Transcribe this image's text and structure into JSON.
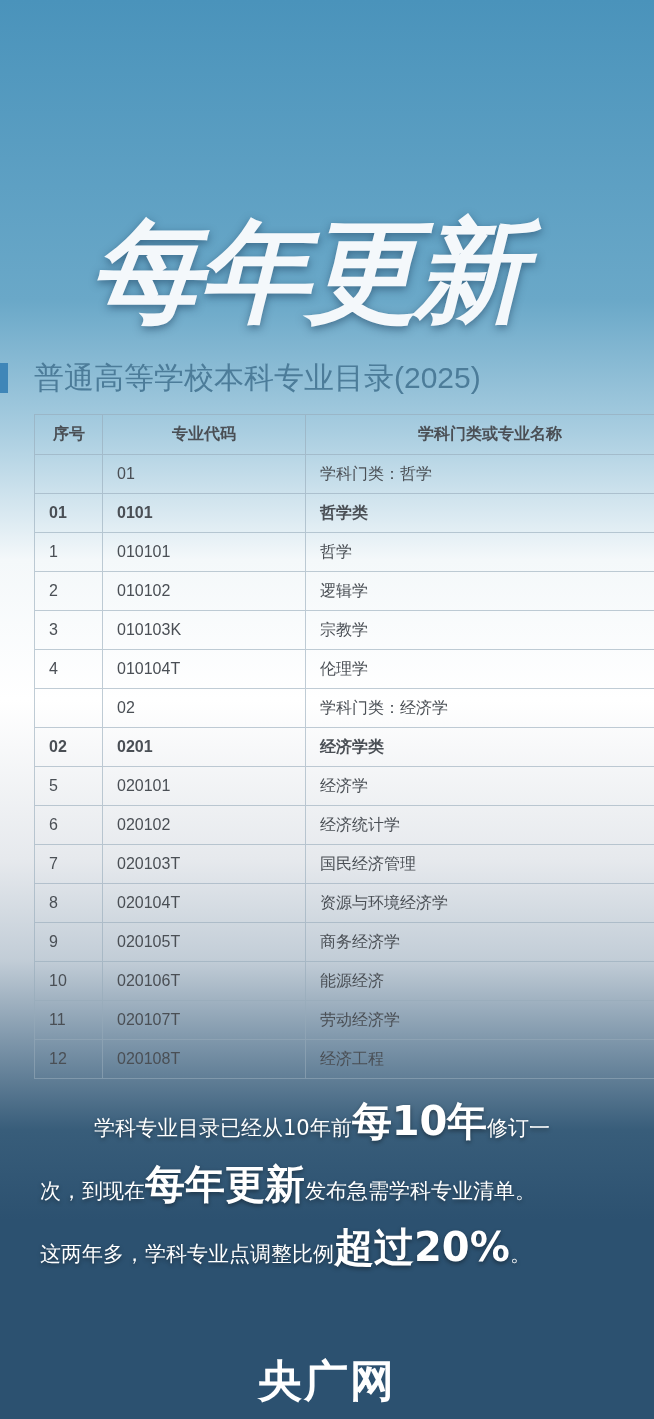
{
  "headline": "每年更新",
  "document": {
    "title": "普通高等学校本科专业目录(2025)",
    "table": {
      "columns": [
        "序号",
        "专业代码",
        "学科门类或专业名称"
      ],
      "rows": [
        {
          "kind": "category",
          "cells": [
            "",
            "01",
            "学科门类：哲学"
          ]
        },
        {
          "kind": "class",
          "cells": [
            "01",
            "0101",
            "哲学类"
          ]
        },
        {
          "kind": "major",
          "cells": [
            "1",
            "010101",
            "哲学"
          ]
        },
        {
          "kind": "major",
          "cells": [
            "2",
            "010102",
            "逻辑学"
          ]
        },
        {
          "kind": "major",
          "cells": [
            "3",
            "010103K",
            "宗教学"
          ]
        },
        {
          "kind": "major",
          "cells": [
            "4",
            "010104T",
            "伦理学"
          ]
        },
        {
          "kind": "category",
          "cells": [
            "",
            "02",
            "学科门类：经济学"
          ]
        },
        {
          "kind": "class",
          "cells": [
            "02",
            "0201",
            "经济学类"
          ]
        },
        {
          "kind": "major",
          "cells": [
            "5",
            "020101",
            "经济学"
          ]
        },
        {
          "kind": "major",
          "cells": [
            "6",
            "020102",
            "经济统计学"
          ]
        },
        {
          "kind": "major",
          "cells": [
            "7",
            "020103T",
            "国民经济管理"
          ]
        },
        {
          "kind": "major",
          "cells": [
            "8",
            "020104T",
            "资源与环境经济学"
          ]
        },
        {
          "kind": "major",
          "cells": [
            "9",
            "020105T",
            "商务经济学"
          ]
        },
        {
          "kind": "major",
          "cells": [
            "10",
            "020106T",
            "能源经济"
          ]
        },
        {
          "kind": "major",
          "cells": [
            "11",
            "020107T",
            "劳动经济学"
          ]
        },
        {
          "kind": "major",
          "cells": [
            "12",
            "020108T",
            "经济工程"
          ]
        }
      ]
    }
  },
  "summary": {
    "lines": [
      [
        {
          "text": "学科专业目录已经从10年前",
          "emphasis": false
        },
        {
          "text": "每10年",
          "emphasis": true
        },
        {
          "text": "修订一",
          "emphasis": false
        }
      ],
      [
        {
          "text": "次，到现在",
          "emphasis": false
        },
        {
          "text": "每年更新",
          "emphasis": true
        },
        {
          "text": "发布急需学科专业清单。",
          "emphasis": false
        }
      ],
      [
        {
          "text": "这两年多，学科专业点调整比例",
          "emphasis": false
        },
        {
          "text": "超过20%",
          "emphasis": true
        },
        {
          "text": "。",
          "emphasis": false
        }
      ]
    ]
  },
  "logo": "央广网"
}
